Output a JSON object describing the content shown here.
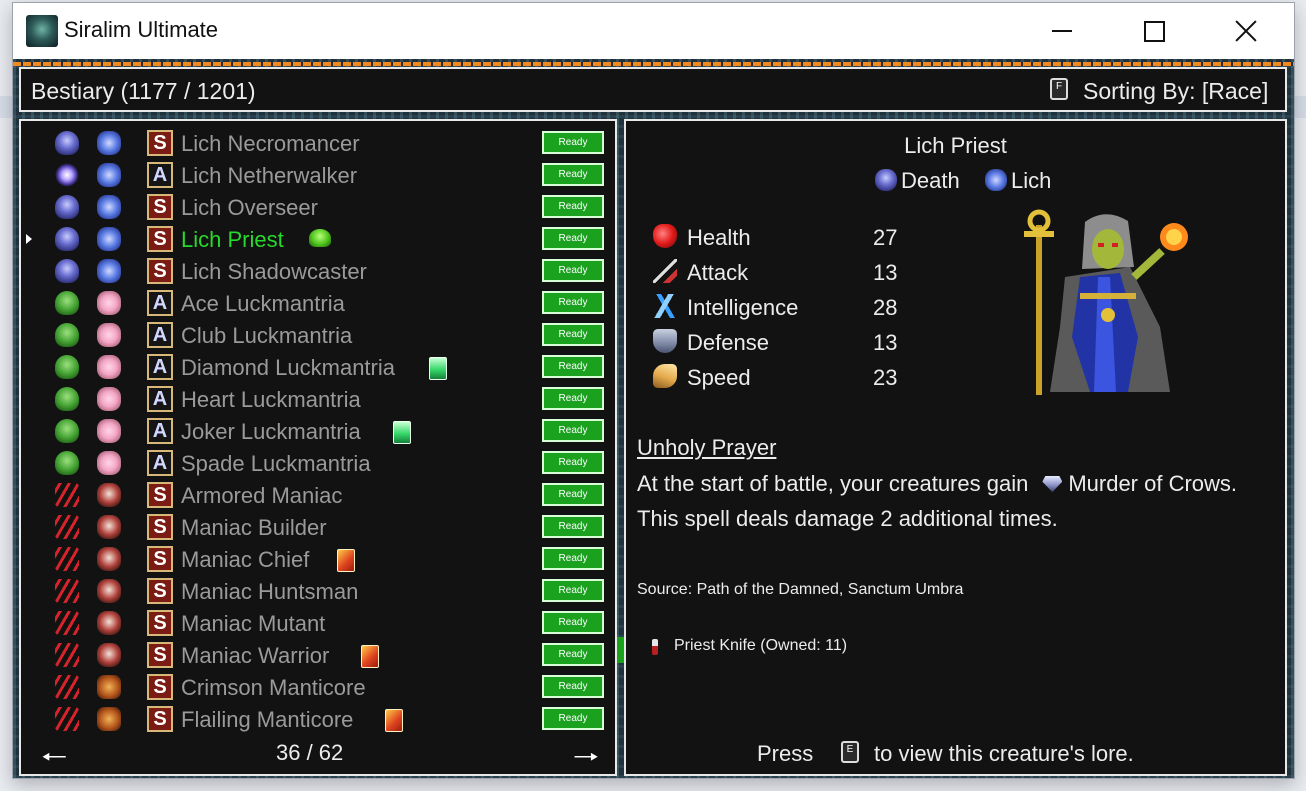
{
  "window": {
    "title": "Siralim Ultimate",
    "app_icon": "siralim-app-icon"
  },
  "header": {
    "title": "Bestiary (1177 / 1201)",
    "sort_key": "F",
    "sort_label": "Sorting By: [Race]"
  },
  "list": {
    "status_label": "Ready",
    "rows": [
      {
        "name": "Lich Necromancer",
        "class_icon": "death",
        "race_icon": "lich",
        "letter": "S",
        "badge": null,
        "selected": false
      },
      {
        "name": "Lich Netherwalker",
        "class_icon": "arcane",
        "race_icon": "lich",
        "letter": "A",
        "badge": null,
        "selected": false
      },
      {
        "name": "Lich Overseer",
        "class_icon": "death",
        "race_icon": "lich",
        "letter": "S",
        "badge": null,
        "selected": false
      },
      {
        "name": "Lich Priest",
        "class_icon": "death",
        "race_icon": "lich",
        "letter": "S",
        "badge": "slime",
        "selected": true
      },
      {
        "name": "Lich Shadowcaster",
        "class_icon": "death",
        "race_icon": "lich",
        "letter": "S",
        "badge": null,
        "selected": false
      },
      {
        "name": "Ace Luckmantria",
        "class_icon": "life",
        "race_icon": "mantria",
        "letter": "A",
        "badge": null,
        "selected": false
      },
      {
        "name": "Club Luckmantria",
        "class_icon": "life",
        "race_icon": "mantria",
        "letter": "A",
        "badge": null,
        "selected": false
      },
      {
        "name": "Diamond Luckmantria",
        "class_icon": "life",
        "race_icon": "mantria",
        "letter": "A",
        "badge": "gem",
        "selected": false
      },
      {
        "name": "Heart Luckmantria",
        "class_icon": "life",
        "race_icon": "mantria",
        "letter": "A",
        "badge": null,
        "selected": false
      },
      {
        "name": "Joker Luckmantria",
        "class_icon": "life",
        "race_icon": "mantria",
        "letter": "A",
        "badge": "gem",
        "selected": false
      },
      {
        "name": "Spade Luckmantria",
        "class_icon": "life",
        "race_icon": "mantria",
        "letter": "A",
        "badge": null,
        "selected": false
      },
      {
        "name": "Armored Maniac",
        "class_icon": "chaos",
        "race_icon": "maniac",
        "letter": "S",
        "badge": null,
        "selected": false
      },
      {
        "name": "Maniac Builder",
        "class_icon": "chaos",
        "race_icon": "maniac",
        "letter": "S",
        "badge": null,
        "selected": false
      },
      {
        "name": "Maniac Chief",
        "class_icon": "chaos",
        "race_icon": "maniac",
        "letter": "S",
        "badge": "card",
        "selected": false
      },
      {
        "name": "Maniac Huntsman",
        "class_icon": "chaos",
        "race_icon": "maniac",
        "letter": "S",
        "badge": null,
        "selected": false
      },
      {
        "name": "Maniac Mutant",
        "class_icon": "chaos",
        "race_icon": "maniac",
        "letter": "S",
        "badge": null,
        "selected": false
      },
      {
        "name": "Maniac Warrior",
        "class_icon": "chaos",
        "race_icon": "maniac",
        "letter": "S",
        "badge": "card",
        "selected": false
      },
      {
        "name": "Crimson Manticore",
        "class_icon": "chaos",
        "race_icon": "manticore",
        "letter": "S",
        "badge": null,
        "selected": false
      },
      {
        "name": "Flailing Manticore",
        "class_icon": "chaos",
        "race_icon": "manticore",
        "letter": "S",
        "badge": "card",
        "selected": false
      }
    ],
    "page": "36 / 62"
  },
  "detail": {
    "name": "Lich Priest",
    "class": "Death",
    "race": "Lich",
    "stats": [
      {
        "label": "Health",
        "value": "27",
        "icon": "heart"
      },
      {
        "label": "Attack",
        "value": "13",
        "icon": "sword"
      },
      {
        "label": "Intelligence",
        "value": "28",
        "icon": "lightning"
      },
      {
        "label": "Defense",
        "value": "13",
        "icon": "shield"
      },
      {
        "label": "Speed",
        "value": "23",
        "icon": "wing"
      }
    ],
    "ability_name": "Unholy Prayer",
    "ability_desc_before": "At the start of battle, your creatures gain",
    "ability_desc_after": "Murder of Crows. This spell deals damage 2 additional times.",
    "source": "Source: Path of the Damned, Sanctum Umbra",
    "item": "Priest Knife (Owned: 11)",
    "lore_press": "Press",
    "lore_key": "E",
    "lore_rest": "to view this creature's lore."
  }
}
